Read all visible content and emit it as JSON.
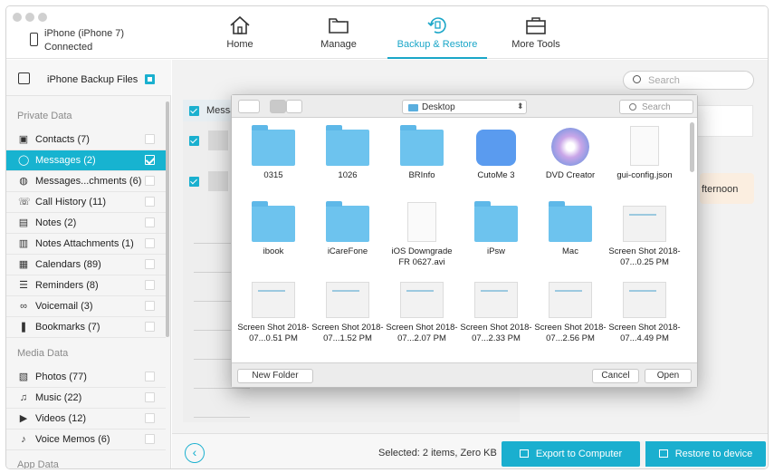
{
  "device": {
    "name": "iPhone (iPhone 7)",
    "status": "Connected"
  },
  "tabs": [
    {
      "label": "Home",
      "icon": "home-icon"
    },
    {
      "label": "Manage",
      "icon": "folder-icon"
    },
    {
      "label": "Backup & Restore",
      "icon": "backup-restore-icon",
      "active": true
    },
    {
      "label": "More Tools",
      "icon": "toolbox-icon"
    }
  ],
  "sidebar": {
    "header": "iPhone Backup Files",
    "sections": [
      "Private Data",
      "Media Data",
      "App Data"
    ],
    "items": [
      {
        "label": "Contacts (7)",
        "icon": "contacts-icon"
      },
      {
        "label": "Messages (2)",
        "icon": "messages-icon",
        "active": true
      },
      {
        "label": "Messages...chments (6)",
        "icon": "attachment-icon"
      },
      {
        "label": "Call History (11)",
        "icon": "phone-icon"
      },
      {
        "label": "Notes (2)",
        "icon": "notes-icon"
      },
      {
        "label": "Notes Attachments (1)",
        "icon": "notes-attachment-icon"
      },
      {
        "label": "Calendars (89)",
        "icon": "calendar-icon"
      },
      {
        "label": "Reminders (8)",
        "icon": "reminders-icon"
      },
      {
        "label": "Voicemail (3)",
        "icon": "voicemail-icon"
      },
      {
        "label": "Bookmarks (7)",
        "icon": "bookmark-icon"
      },
      {
        "label": "Photos (77)",
        "icon": "photos-icon"
      },
      {
        "label": "Music (22)",
        "icon": "music-icon"
      },
      {
        "label": "Videos (12)",
        "icon": "videos-icon"
      },
      {
        "label": "Voice Memos (6)",
        "icon": "voice-memo-icon"
      }
    ]
  },
  "main": {
    "search_placeholder": "Search",
    "messages_header": "Messa",
    "bubble_text": "fternoon",
    "selected_text": "Selected: 2 items, Zero KB",
    "export_button": "Export to Computer",
    "restore_button": "Restore to device"
  },
  "dialog": {
    "location": "Desktop",
    "search_placeholder": "Search",
    "files": [
      {
        "name": "0315",
        "kind": "folder"
      },
      {
        "name": "1026",
        "kind": "folder"
      },
      {
        "name": "BRInfo",
        "kind": "folder"
      },
      {
        "name": "CutoMe 3",
        "kind": "app"
      },
      {
        "name": "DVD Creator",
        "kind": "app-disc"
      },
      {
        "name": "gui-config.json",
        "kind": "document"
      },
      {
        "name": "ibook",
        "kind": "folder"
      },
      {
        "name": "iCareFone",
        "kind": "folder"
      },
      {
        "name": "iOS Downgrade FR 0627.avi",
        "kind": "video"
      },
      {
        "name": "iPsw",
        "kind": "folder"
      },
      {
        "name": "Mac",
        "kind": "folder"
      },
      {
        "name": "Screen Shot 2018-07...0.25 PM",
        "kind": "screenshot"
      },
      {
        "name": "Screen Shot 2018-07...0.51 PM",
        "kind": "screenshot"
      },
      {
        "name": "Screen Shot 2018-07...1.52 PM",
        "kind": "screenshot"
      },
      {
        "name": "Screen Shot 2018-07...2.07 PM",
        "kind": "screenshot"
      },
      {
        "name": "Screen Shot 2018-07...2.33 PM",
        "kind": "screenshot"
      },
      {
        "name": "Screen Shot 2018-07...2.56 PM",
        "kind": "screenshot"
      },
      {
        "name": "Screen Shot 2018-07...4.49 PM",
        "kind": "screenshot"
      }
    ],
    "new_folder": "New Folder",
    "cancel": "Cancel",
    "open": "Open"
  }
}
